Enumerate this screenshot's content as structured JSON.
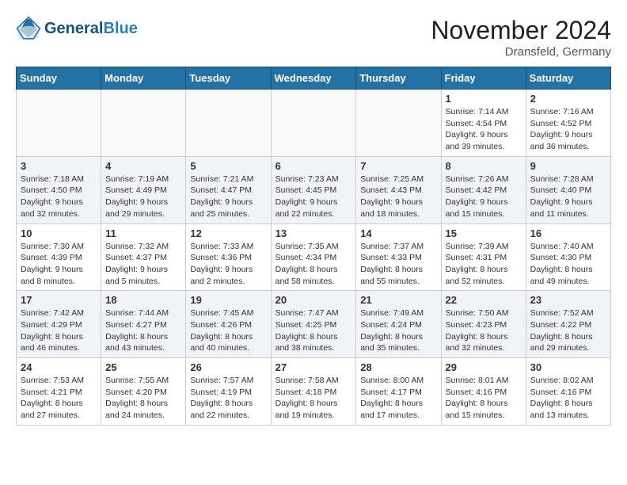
{
  "header": {
    "logo_line1": "General",
    "logo_line2": "Blue",
    "month": "November 2024",
    "location": "Dransfeld, Germany"
  },
  "weekdays": [
    "Sunday",
    "Monday",
    "Tuesday",
    "Wednesday",
    "Thursday",
    "Friday",
    "Saturday"
  ],
  "weeks": [
    [
      {
        "day": "",
        "info": ""
      },
      {
        "day": "",
        "info": ""
      },
      {
        "day": "",
        "info": ""
      },
      {
        "day": "",
        "info": ""
      },
      {
        "day": "",
        "info": ""
      },
      {
        "day": "1",
        "info": "Sunrise: 7:14 AM\nSunset: 4:54 PM\nDaylight: 9 hours and 39 minutes."
      },
      {
        "day": "2",
        "info": "Sunrise: 7:16 AM\nSunset: 4:52 PM\nDaylight: 9 hours and 36 minutes."
      }
    ],
    [
      {
        "day": "3",
        "info": "Sunrise: 7:18 AM\nSunset: 4:50 PM\nDaylight: 9 hours and 32 minutes."
      },
      {
        "day": "4",
        "info": "Sunrise: 7:19 AM\nSunset: 4:49 PM\nDaylight: 9 hours and 29 minutes."
      },
      {
        "day": "5",
        "info": "Sunrise: 7:21 AM\nSunset: 4:47 PM\nDaylight: 9 hours and 25 minutes."
      },
      {
        "day": "6",
        "info": "Sunrise: 7:23 AM\nSunset: 4:45 PM\nDaylight: 9 hours and 22 minutes."
      },
      {
        "day": "7",
        "info": "Sunrise: 7:25 AM\nSunset: 4:43 PM\nDaylight: 9 hours and 18 minutes."
      },
      {
        "day": "8",
        "info": "Sunrise: 7:26 AM\nSunset: 4:42 PM\nDaylight: 9 hours and 15 minutes."
      },
      {
        "day": "9",
        "info": "Sunrise: 7:28 AM\nSunset: 4:40 PM\nDaylight: 9 hours and 11 minutes."
      }
    ],
    [
      {
        "day": "10",
        "info": "Sunrise: 7:30 AM\nSunset: 4:39 PM\nDaylight: 9 hours and 8 minutes."
      },
      {
        "day": "11",
        "info": "Sunrise: 7:32 AM\nSunset: 4:37 PM\nDaylight: 9 hours and 5 minutes."
      },
      {
        "day": "12",
        "info": "Sunrise: 7:33 AM\nSunset: 4:36 PM\nDaylight: 9 hours and 2 minutes."
      },
      {
        "day": "13",
        "info": "Sunrise: 7:35 AM\nSunset: 4:34 PM\nDaylight: 8 hours and 58 minutes."
      },
      {
        "day": "14",
        "info": "Sunrise: 7:37 AM\nSunset: 4:33 PM\nDaylight: 8 hours and 55 minutes."
      },
      {
        "day": "15",
        "info": "Sunrise: 7:39 AM\nSunset: 4:31 PM\nDaylight: 8 hours and 52 minutes."
      },
      {
        "day": "16",
        "info": "Sunrise: 7:40 AM\nSunset: 4:30 PM\nDaylight: 8 hours and 49 minutes."
      }
    ],
    [
      {
        "day": "17",
        "info": "Sunrise: 7:42 AM\nSunset: 4:29 PM\nDaylight: 8 hours and 46 minutes."
      },
      {
        "day": "18",
        "info": "Sunrise: 7:44 AM\nSunset: 4:27 PM\nDaylight: 8 hours and 43 minutes."
      },
      {
        "day": "19",
        "info": "Sunrise: 7:45 AM\nSunset: 4:26 PM\nDaylight: 8 hours and 40 minutes."
      },
      {
        "day": "20",
        "info": "Sunrise: 7:47 AM\nSunset: 4:25 PM\nDaylight: 8 hours and 38 minutes."
      },
      {
        "day": "21",
        "info": "Sunrise: 7:49 AM\nSunset: 4:24 PM\nDaylight: 8 hours and 35 minutes."
      },
      {
        "day": "22",
        "info": "Sunrise: 7:50 AM\nSunset: 4:23 PM\nDaylight: 8 hours and 32 minutes."
      },
      {
        "day": "23",
        "info": "Sunrise: 7:52 AM\nSunset: 4:22 PM\nDaylight: 8 hours and 29 minutes."
      }
    ],
    [
      {
        "day": "24",
        "info": "Sunrise: 7:53 AM\nSunset: 4:21 PM\nDaylight: 8 hours and 27 minutes."
      },
      {
        "day": "25",
        "info": "Sunrise: 7:55 AM\nSunset: 4:20 PM\nDaylight: 8 hours and 24 minutes."
      },
      {
        "day": "26",
        "info": "Sunrise: 7:57 AM\nSunset: 4:19 PM\nDaylight: 8 hours and 22 minutes."
      },
      {
        "day": "27",
        "info": "Sunrise: 7:58 AM\nSunset: 4:18 PM\nDaylight: 8 hours and 19 minutes."
      },
      {
        "day": "28",
        "info": "Sunrise: 8:00 AM\nSunset: 4:17 PM\nDaylight: 8 hours and 17 minutes."
      },
      {
        "day": "29",
        "info": "Sunrise: 8:01 AM\nSunset: 4:16 PM\nDaylight: 8 hours and 15 minutes."
      },
      {
        "day": "30",
        "info": "Sunrise: 8:02 AM\nSunset: 4:16 PM\nDaylight: 8 hours and 13 minutes."
      }
    ]
  ]
}
